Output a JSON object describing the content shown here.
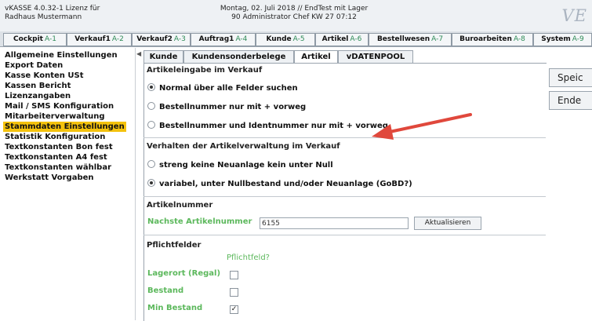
{
  "titlebar": {
    "left_line1": "vKASSE 4.0.32-1 Lizenz für",
    "left_line2": "Radhaus Mustermann",
    "center_line1": "Montag, 02. Juli 2018 // EndTest mit Lager",
    "center_line2": "90 Administrator Chef   KW 27 07:12",
    "logo": "VE"
  },
  "tabs": [
    {
      "label": "Cockpit",
      "hotkey": "A-1"
    },
    {
      "label": "Verkauf1",
      "hotkey": "A-2"
    },
    {
      "label": "Verkauf2",
      "hotkey": "A-3"
    },
    {
      "label": "Auftrag1",
      "hotkey": "A-4"
    },
    {
      "label": "Kunde",
      "hotkey": "A-5"
    },
    {
      "label": "Artikel",
      "hotkey": "A-6"
    },
    {
      "label": "Bestellwesen",
      "hotkey": "A-7"
    },
    {
      "label": "Buroarbeiten",
      "hotkey": "A-8"
    },
    {
      "label": "System",
      "hotkey": "A-9"
    }
  ],
  "sidebar": {
    "items": [
      "Allgemeine Einstellungen",
      "Export Daten",
      "Kasse Konten USt",
      "Kassen Bericht",
      "Lizenzangaben",
      "Mail / SMS Konfiguration",
      "Mitarbeiterverwaltung",
      "Stammdaten Einstellungen",
      "Statistik Konfiguration",
      "Textkonstanten Bon fest",
      "Textkonstanten A4 fest",
      "Textkonstanten wählbar",
      "Werkstatt Vorgaben"
    ]
  },
  "subtabs": [
    "Kunde",
    "Kundensonderbelege",
    "Artikel",
    "vDATENPOOL"
  ],
  "section1": {
    "title": "Artikeleingabe im Verkauf",
    "options": [
      "Normal über alle Felder suchen",
      "Bestellnummer nur mit + vorweg",
      "Bestellnummer und Identnummer nur mit + vorweg"
    ]
  },
  "section2": {
    "title": "Verhalten der Artikelverwaltung im Verkauf",
    "options": [
      "streng keine Neuanlage kein unter Null",
      "variabel, unter Nullbestand und/oder Neuanlage (GoBD?)"
    ]
  },
  "section3": {
    "title": "Artikelnummer",
    "label": "Nachste Artikelnummer",
    "value": "6155",
    "button": "Aktualisieren"
  },
  "section4": {
    "title": "Pflichtfelder",
    "column_header": "Pflichtfeld?",
    "fields": [
      {
        "label": "Lagerort (Regal)",
        "checked": false
      },
      {
        "label": "Bestand",
        "checked": false
      },
      {
        "label": "Min Bestand",
        "checked": true
      }
    ]
  },
  "actions": {
    "save": "Speic",
    "end": "Ende"
  }
}
